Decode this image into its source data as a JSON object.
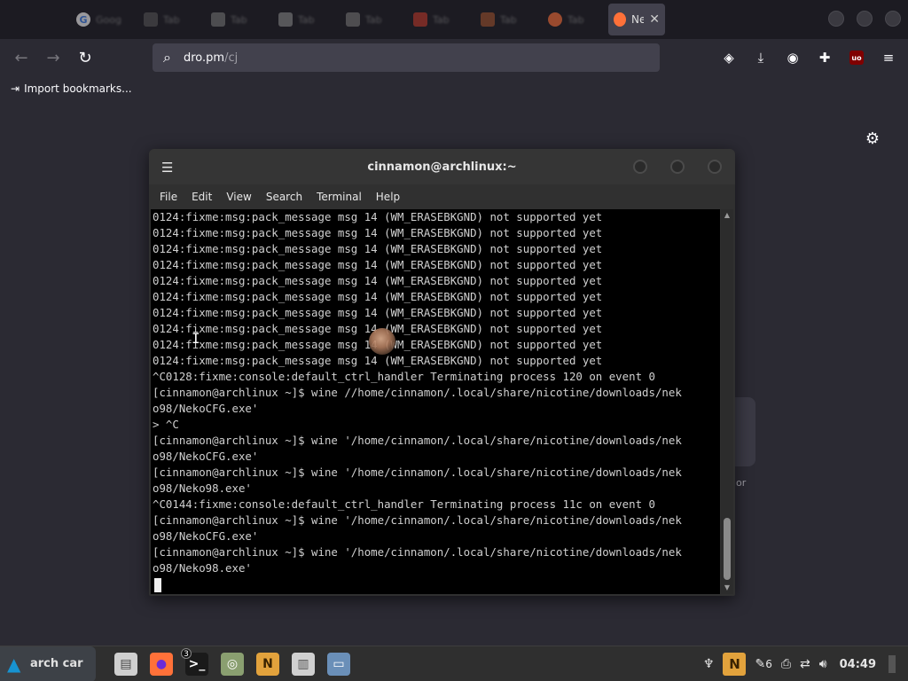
{
  "browser": {
    "tabs": [
      {
        "icon": "google-icon",
        "title": "Google",
        "color": "#4285f4"
      },
      {
        "icon": "tab-favicon",
        "title": "Tab",
        "color": "#555555"
      },
      {
        "icon": "tab-favicon",
        "title": "Tab",
        "color": "#777777"
      },
      {
        "icon": "grid-icon",
        "title": "Tab",
        "color": "#888888"
      },
      {
        "icon": "tab-favicon",
        "title": "Tab",
        "color": "#777777"
      },
      {
        "icon": "tab-favicon",
        "title": "Tab",
        "color": "#c0392b"
      },
      {
        "icon": "tab-favicon",
        "title": "Tab",
        "color": "#a0522d"
      },
      {
        "icon": "firefox-icon",
        "title": "Tab",
        "color": "#ff7139"
      }
    ],
    "active_tab": {
      "title": "Ne",
      "icon": "firefox-icon",
      "color": "#ff7139"
    },
    "url_host": "dro.pm",
    "url_path": "/cj",
    "bookmarks": {
      "import_label": "Import bookmarks..."
    },
    "ghost_text": "or"
  },
  "terminal": {
    "title": "cinnamon@archlinux:~",
    "menu": [
      "File",
      "Edit",
      "View",
      "Search",
      "Terminal",
      "Help"
    ],
    "lines": [
      "0124:fixme:msg:pack_message msg 14 (WM_ERASEBKGND) not supported yet",
      "0124:fixme:msg:pack_message msg 14 (WM_ERASEBKGND) not supported yet",
      "0124:fixme:msg:pack_message msg 14 (WM_ERASEBKGND) not supported yet",
      "0124:fixme:msg:pack_message msg 14 (WM_ERASEBKGND) not supported yet",
      "0124:fixme:msg:pack_message msg 14 (WM_ERASEBKGND) not supported yet",
      "0124:fixme:msg:pack_message msg 14 (WM_ERASEBKGND) not supported yet",
      "0124:fixme:msg:pack_message msg 14 (WM_ERASEBKGND) not supported yet",
      "0124:fixme:msg:pack_message msg 14 (WM_ERASEBKGND) not supported yet",
      "0124:fixme:msg:pack_message msg 14 (WM_ERASEBKGND) not supported yet",
      "0124:fixme:msg:pack_message msg 14 (WM_ERASEBKGND) not supported yet",
      "^C0128:fixme:console:default_ctrl_handler Terminating process 120 on event 0",
      "[cinnamon@archlinux ~]$ wine //home/cinnamon/.local/share/nicotine/downloads/nek",
      "o98/NekoCFG.exe'",
      "> ^C",
      "[cinnamon@archlinux ~]$ wine '/home/cinnamon/.local/share/nicotine/downloads/nek",
      "o98/NekoCFG.exe'",
      "[cinnamon@archlinux ~]$ wine '/home/cinnamon/.local/share/nicotine/downloads/nek",
      "o98/Neko98.exe'",
      "^C0144:fixme:console:default_ctrl_handler Terminating process 11c on event 0",
      "[cinnamon@archlinux ~]$ wine '/home/cinnamon/.local/share/nicotine/downloads/nek",
      "o98/NekoCFG.exe'",
      "[cinnamon@archlinux ~]$ wine '/home/cinnamon/.local/share/nicotine/downloads/nek",
      "o98/Neko98.exe'"
    ]
  },
  "taskbar": {
    "start_label": "arch car",
    "apps": [
      {
        "name": "file-cabinet-app",
        "symbol": "▤",
        "bg": "#cfcfcf",
        "fg": "#444444"
      },
      {
        "name": "firefox-app",
        "symbol": "●",
        "bg": "#ff7139",
        "fg": "#6b2bd9"
      },
      {
        "name": "terminal-app",
        "symbol": ">_",
        "bg": "#1a1a1a",
        "fg": "#ffffff",
        "badge": "3"
      },
      {
        "name": "control-panel-app",
        "symbol": "◎",
        "bg": "#8a9f70",
        "fg": "#ffffff"
      },
      {
        "name": "neko-app",
        "symbol": "N",
        "bg": "#e2a23c",
        "fg": "#3a2300"
      },
      {
        "name": "file-manager-app",
        "symbol": "▥",
        "bg": "#d0d0d0",
        "fg": "#555555"
      },
      {
        "name": "scanner-app",
        "symbol": "▭",
        "bg": "#6a8fb8",
        "fg": "#ffffff"
      }
    ],
    "tray": {
      "notifications_count": "6",
      "clock": "04:49"
    }
  }
}
